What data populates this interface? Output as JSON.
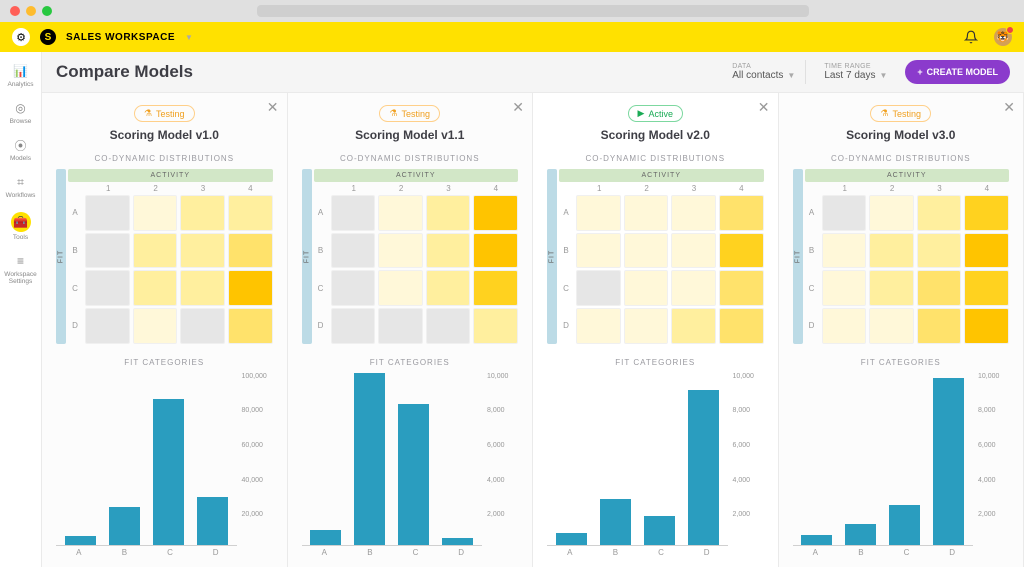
{
  "workspace": {
    "label": "SALES WORKSPACE"
  },
  "sidebar": {
    "items": [
      {
        "label": "Analytics",
        "icon": "📊"
      },
      {
        "label": "Browse",
        "icon": "◎"
      },
      {
        "label": "Models",
        "icon": "⦿"
      },
      {
        "label": "Workflows",
        "icon": "⌗"
      },
      {
        "label": "Tools",
        "icon": "🧰"
      },
      {
        "label": "Workspace Settings",
        "icon": "≡"
      }
    ]
  },
  "page": {
    "title": "Compare Models"
  },
  "data_selector": {
    "label": "DATA",
    "value": "All contacts"
  },
  "time_selector": {
    "label": "TIME RANGE",
    "value": "Last 7 days"
  },
  "create_button": "CREATE MODEL",
  "status": {
    "testing": "Testing",
    "active": "Active"
  },
  "labels": {
    "co_dynamic": "CO-DYNAMIC DISTRIBUTIONS",
    "activity": "ACTIVITY",
    "fit": "FIT",
    "fit_categories": "FIT CATEGORIES"
  },
  "models": [
    {
      "name": "Scoring Model v1.0",
      "status": "testing"
    },
    {
      "name": "Scoring Model v1.1",
      "status": "testing"
    },
    {
      "name": "Scoring Model v2.0",
      "status": "active"
    },
    {
      "name": "Scoring Model v3.0",
      "status": "testing"
    }
  ],
  "axis_rows": [
    "A",
    "B",
    "C",
    "D"
  ],
  "axis_cols": [
    "1",
    "2",
    "3",
    "4"
  ],
  "chart_data": [
    {
      "type": "compound",
      "title": "Scoring Model v1.0",
      "heatmap": {
        "type": "heatmap",
        "xlabel": "ACTIVITY",
        "ylabel": "FIT",
        "x": [
          "1",
          "2",
          "3",
          "4"
        ],
        "y": [
          "A",
          "B",
          "C",
          "D"
        ],
        "values": [
          [
            0,
            1,
            2,
            2
          ],
          [
            0,
            2,
            2,
            3
          ],
          [
            0,
            2,
            2,
            5
          ],
          [
            0,
            1,
            0,
            3
          ]
        ],
        "color_scale": [
          "#e6e6e6",
          "#fff8d9",
          "#ffef9e",
          "#ffe26b",
          "#ffd21f",
          "#ffc400"
        ]
      },
      "bar": {
        "type": "bar",
        "title": "FIT CATEGORIES",
        "categories": [
          "A",
          "B",
          "C",
          "D"
        ],
        "values": [
          5000,
          22000,
          85000,
          28000
        ],
        "ylim": [
          0,
          100000
        ],
        "yticks": [
          100000,
          80000,
          60000,
          40000,
          20000,
          0
        ],
        "ytick_labels": [
          "100,000",
          "80,000",
          "60,000",
          "40,000",
          "20,000",
          ""
        ]
      }
    },
    {
      "type": "compound",
      "title": "Scoring Model v1.1",
      "heatmap": {
        "type": "heatmap",
        "xlabel": "ACTIVITY",
        "ylabel": "FIT",
        "x": [
          "1",
          "2",
          "3",
          "4"
        ],
        "y": [
          "A",
          "B",
          "C",
          "D"
        ],
        "values": [
          [
            0,
            1,
            2,
            5
          ],
          [
            0,
            1,
            2,
            5
          ],
          [
            0,
            1,
            2,
            4
          ],
          [
            0,
            0,
            0,
            2
          ]
        ],
        "color_scale": [
          "#e6e6e6",
          "#fff8d9",
          "#ffef9e",
          "#ffe26b",
          "#ffd21f",
          "#ffc400"
        ]
      },
      "bar": {
        "type": "bar",
        "title": "FIT CATEGORIES",
        "categories": [
          "A",
          "B",
          "C",
          "D"
        ],
        "values": [
          900,
          10000,
          8200,
          400
        ],
        "ylim": [
          0,
          10000
        ],
        "yticks": [
          10000,
          8000,
          6000,
          4000,
          2000,
          0
        ],
        "ytick_labels": [
          "10,000",
          "8,000",
          "6,000",
          "4,000",
          "2,000",
          ""
        ]
      }
    },
    {
      "type": "compound",
      "title": "Scoring Model v2.0",
      "heatmap": {
        "type": "heatmap",
        "xlabel": "ACTIVITY",
        "ylabel": "FIT",
        "x": [
          "1",
          "2",
          "3",
          "4"
        ],
        "y": [
          "A",
          "B",
          "C",
          "D"
        ],
        "values": [
          [
            1,
            1,
            1,
            3
          ],
          [
            1,
            1,
            1,
            4
          ],
          [
            0,
            1,
            1,
            3
          ],
          [
            1,
            1,
            2,
            3
          ]
        ],
        "color_scale": [
          "#e6e6e6",
          "#fff8d9",
          "#ffef9e",
          "#ffe26b",
          "#ffd21f",
          "#ffc400"
        ]
      },
      "bar": {
        "type": "bar",
        "title": "FIT CATEGORIES",
        "categories": [
          "A",
          "B",
          "C",
          "D"
        ],
        "values": [
          700,
          2700,
          1700,
          9000
        ],
        "ylim": [
          0,
          10000
        ],
        "yticks": [
          10000,
          8000,
          6000,
          4000,
          2000,
          0
        ],
        "ytick_labels": [
          "10,000",
          "8,000",
          "6,000",
          "4,000",
          "2,000",
          ""
        ]
      }
    },
    {
      "type": "compound",
      "title": "Scoring Model v3.0",
      "heatmap": {
        "type": "heatmap",
        "xlabel": "ACTIVITY",
        "ylabel": "FIT",
        "x": [
          "1",
          "2",
          "3",
          "4"
        ],
        "y": [
          "A",
          "B",
          "C",
          "D"
        ],
        "values": [
          [
            0,
            1,
            2,
            4
          ],
          [
            1,
            2,
            2,
            5
          ],
          [
            1,
            2,
            3,
            4
          ],
          [
            1,
            1,
            3,
            5
          ]
        ],
        "color_scale": [
          "#e6e6e6",
          "#fff8d9",
          "#ffef9e",
          "#ffe26b",
          "#ffd21f",
          "#ffc400"
        ]
      },
      "bar": {
        "type": "bar",
        "title": "FIT CATEGORIES",
        "categories": [
          "A",
          "B",
          "C",
          "D"
        ],
        "values": [
          600,
          1200,
          2300,
          9700
        ],
        "ylim": [
          0,
          10000
        ],
        "yticks": [
          10000,
          8000,
          6000,
          4000,
          2000,
          0
        ],
        "ytick_labels": [
          "10,000",
          "8,000",
          "6,000",
          "4,000",
          "2,000",
          ""
        ]
      }
    }
  ]
}
